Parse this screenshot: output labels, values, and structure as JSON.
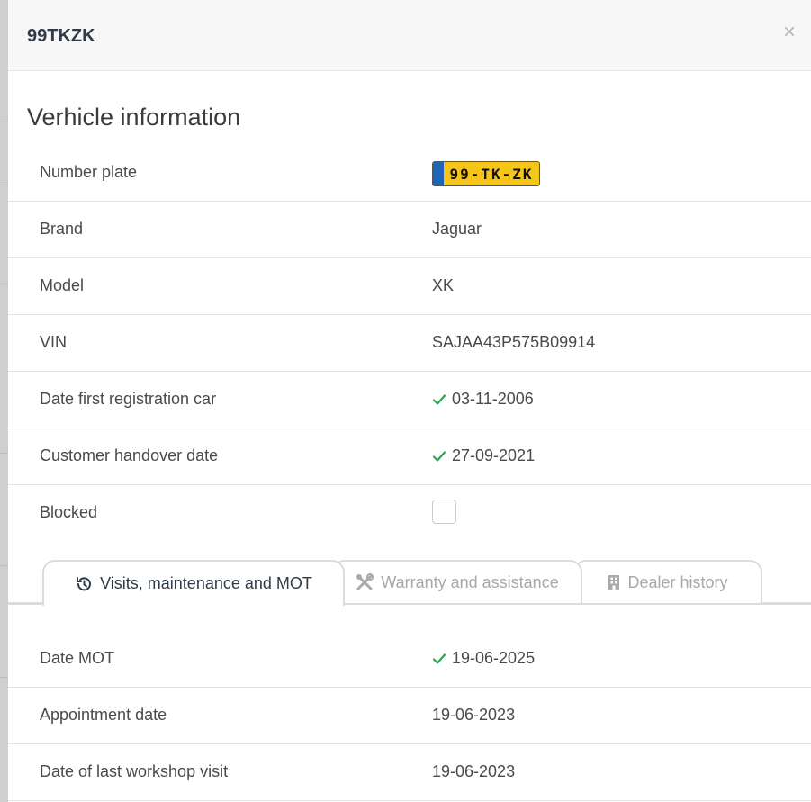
{
  "modal": {
    "title": "99TKZK",
    "close_label": "×"
  },
  "vehicle": {
    "section_title": "Verhicle information",
    "rows": [
      {
        "label": "Number plate",
        "plate": "99-TK-ZK"
      },
      {
        "label": "Brand",
        "value": "Jaguar"
      },
      {
        "label": "Model",
        "value": "XK"
      },
      {
        "label": "VIN",
        "value": "SAJAA43P575B09914"
      },
      {
        "label": "Date first registration car",
        "value": "03-11-2006"
      },
      {
        "label": "Customer handover date",
        "value": "27-09-2021"
      },
      {
        "label": "Blocked"
      }
    ]
  },
  "tabs": [
    {
      "label": "Visits, maintenance and MOT",
      "icon": "history-icon"
    },
    {
      "label": "Warranty and assistance",
      "icon": "tools-icon"
    },
    {
      "label": "Dealer history",
      "icon": "building-icon"
    }
  ],
  "visits": {
    "rows": [
      {
        "label": "Date MOT",
        "value": "19-06-2025"
      },
      {
        "label": "Appointment date",
        "value": "19-06-2023"
      },
      {
        "label": "Date of last workshop visit",
        "value": "19-06-2023"
      }
    ]
  },
  "colors": {
    "check": "#2da44e",
    "plate_yellow": "#f5c518",
    "plate_blue": "#1e66b5",
    "active_tab_text": "#2f3b49",
    "inactive_tab_text": "#a9a9a9"
  }
}
